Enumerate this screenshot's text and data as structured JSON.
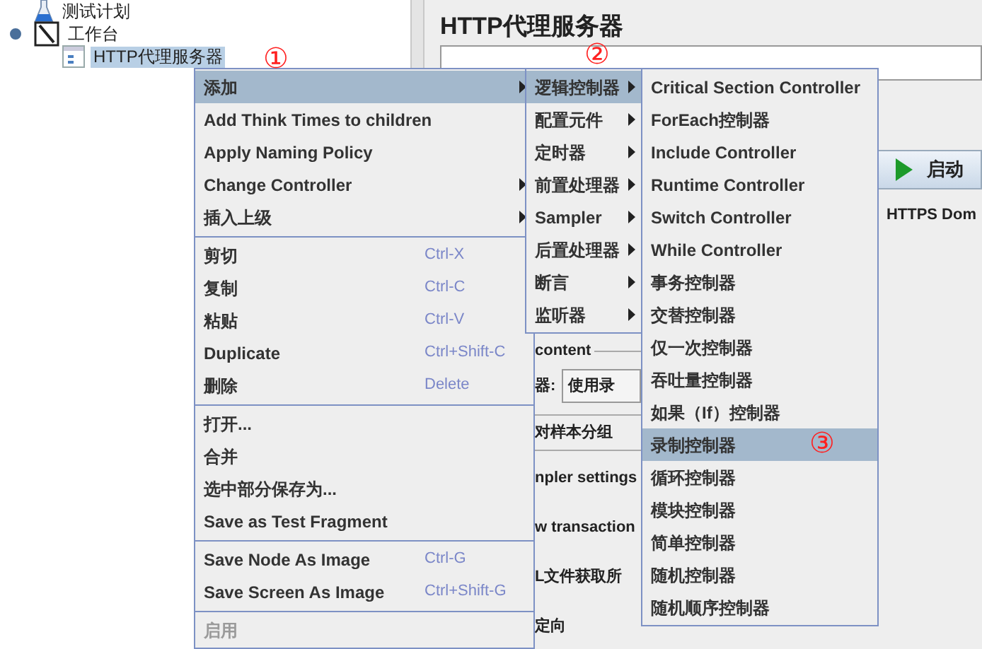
{
  "tree": [
    {
      "label": "测试计划",
      "kind": "plan",
      "selected": false
    },
    {
      "label": "工作台",
      "kind": "workbench",
      "selected": false,
      "expanded": true,
      "children": [
        {
          "label": "HTTP代理服务器",
          "kind": "proxy",
          "selected": true
        }
      ]
    }
  ],
  "panel": {
    "title": "HTTP代理服务器",
    "start_button": "启动",
    "https_label": "HTTPS Dom",
    "fragments": [
      {
        "kind": "group_title",
        "text": "content"
      },
      {
        "kind": "select",
        "text": "器:",
        "value": "使用录"
      },
      {
        "kind": "boxed",
        "text": "对样本分组"
      },
      {
        "kind": "text",
        "text": "npler settings"
      },
      {
        "kind": "text",
        "text": "w transaction"
      },
      {
        "kind": "text",
        "text": "L文件获取所"
      },
      {
        "kind": "text",
        "text": "定向"
      }
    ]
  },
  "context_menu": [
    {
      "kind": "item",
      "label": "添加",
      "submenu": true,
      "selected": true,
      "disabled": false
    },
    {
      "kind": "item",
      "label": "Add Think Times to children",
      "submenu": false,
      "selected": false,
      "disabled": false
    },
    {
      "kind": "item",
      "label": "Apply Naming Policy",
      "submenu": false,
      "selected": false,
      "disabled": false
    },
    {
      "kind": "item",
      "label": "Change Controller",
      "submenu": true,
      "selected": false,
      "disabled": false
    },
    {
      "kind": "item",
      "label": "插入上级",
      "submenu": true,
      "selected": false,
      "disabled": false
    },
    {
      "kind": "separator"
    },
    {
      "kind": "item",
      "label": "剪切",
      "shortcut": "Ctrl-X",
      "submenu": false,
      "selected": false,
      "disabled": false
    },
    {
      "kind": "item",
      "label": "复制",
      "shortcut": "Ctrl-C",
      "submenu": false,
      "selected": false,
      "disabled": false
    },
    {
      "kind": "item",
      "label": "粘贴",
      "shortcut": "Ctrl-V",
      "submenu": false,
      "selected": false,
      "disabled": false
    },
    {
      "kind": "item",
      "label": "Duplicate",
      "shortcut": "Ctrl+Shift-C",
      "submenu": false,
      "selected": false,
      "disabled": false
    },
    {
      "kind": "item",
      "label": "删除",
      "shortcut": "Delete",
      "submenu": false,
      "selected": false,
      "disabled": false
    },
    {
      "kind": "separator"
    },
    {
      "kind": "item",
      "label": "打开...",
      "submenu": false,
      "selected": false,
      "disabled": false
    },
    {
      "kind": "item",
      "label": "合并",
      "submenu": false,
      "selected": false,
      "disabled": false
    },
    {
      "kind": "item",
      "label": "选中部分保存为...",
      "submenu": false,
      "selected": false,
      "disabled": false
    },
    {
      "kind": "item",
      "label": "Save as Test Fragment",
      "submenu": false,
      "selected": false,
      "disabled": false
    },
    {
      "kind": "separator"
    },
    {
      "kind": "item",
      "label": "Save Node As Image",
      "shortcut": "Ctrl-G",
      "submenu": false,
      "selected": false,
      "disabled": false
    },
    {
      "kind": "item",
      "label": "Save Screen As Image",
      "shortcut": "Ctrl+Shift-G",
      "submenu": false,
      "selected": false,
      "disabled": false
    },
    {
      "kind": "separator"
    },
    {
      "kind": "item",
      "label": "启用",
      "submenu": false,
      "selected": false,
      "disabled": true
    }
  ],
  "add_submenu": [
    {
      "kind": "item",
      "label": "逻辑控制器",
      "submenu": true,
      "selected": true,
      "disabled": false
    },
    {
      "kind": "item",
      "label": "配置元件",
      "submenu": true,
      "selected": false,
      "disabled": false
    },
    {
      "kind": "item",
      "label": "定时器",
      "submenu": true,
      "selected": false,
      "disabled": false
    },
    {
      "kind": "item",
      "label": "前置处理器",
      "submenu": true,
      "selected": false,
      "disabled": false
    },
    {
      "kind": "item",
      "label": "Sampler",
      "submenu": true,
      "selected": false,
      "disabled": false
    },
    {
      "kind": "item",
      "label": "后置处理器",
      "submenu": true,
      "selected": false,
      "disabled": false
    },
    {
      "kind": "item",
      "label": "断言",
      "submenu": true,
      "selected": false,
      "disabled": false
    },
    {
      "kind": "item",
      "label": "监听器",
      "submenu": true,
      "selected": false,
      "disabled": false
    }
  ],
  "controller_submenu": [
    {
      "kind": "item",
      "label": "Critical Section Controller",
      "submenu": false,
      "selected": false,
      "disabled": false
    },
    {
      "kind": "item",
      "label": "ForEach控制器",
      "submenu": false,
      "selected": false,
      "disabled": false
    },
    {
      "kind": "item",
      "label": "Include Controller",
      "submenu": false,
      "selected": false,
      "disabled": false
    },
    {
      "kind": "item",
      "label": "Runtime Controller",
      "submenu": false,
      "selected": false,
      "disabled": false
    },
    {
      "kind": "item",
      "label": "Switch Controller",
      "submenu": false,
      "selected": false,
      "disabled": false
    },
    {
      "kind": "item",
      "label": "While Controller",
      "submenu": false,
      "selected": false,
      "disabled": false
    },
    {
      "kind": "item",
      "label": "事务控制器",
      "submenu": false,
      "selected": false,
      "disabled": false
    },
    {
      "kind": "item",
      "label": "交替控制器",
      "submenu": false,
      "selected": false,
      "disabled": false
    },
    {
      "kind": "item",
      "label": "仅一次控制器",
      "submenu": false,
      "selected": false,
      "disabled": false
    },
    {
      "kind": "item",
      "label": "吞吐量控制器",
      "submenu": false,
      "selected": false,
      "disabled": false
    },
    {
      "kind": "item",
      "label": "如果（If）控制器",
      "submenu": false,
      "selected": false,
      "disabled": false
    },
    {
      "kind": "item",
      "label": "录制控制器",
      "submenu": false,
      "selected": true,
      "disabled": false
    },
    {
      "kind": "item",
      "label": "循环控制器",
      "submenu": false,
      "selected": false,
      "disabled": false
    },
    {
      "kind": "item",
      "label": "模块控制器",
      "submenu": false,
      "selected": false,
      "disabled": false
    },
    {
      "kind": "item",
      "label": "简单控制器",
      "submenu": false,
      "selected": false,
      "disabled": false
    },
    {
      "kind": "item",
      "label": "随机控制器",
      "submenu": false,
      "selected": false,
      "disabled": false
    },
    {
      "kind": "item",
      "label": "随机顺序控制器",
      "submenu": false,
      "selected": false,
      "disabled": false
    }
  ],
  "annotations": [
    "①",
    "②",
    "③"
  ]
}
